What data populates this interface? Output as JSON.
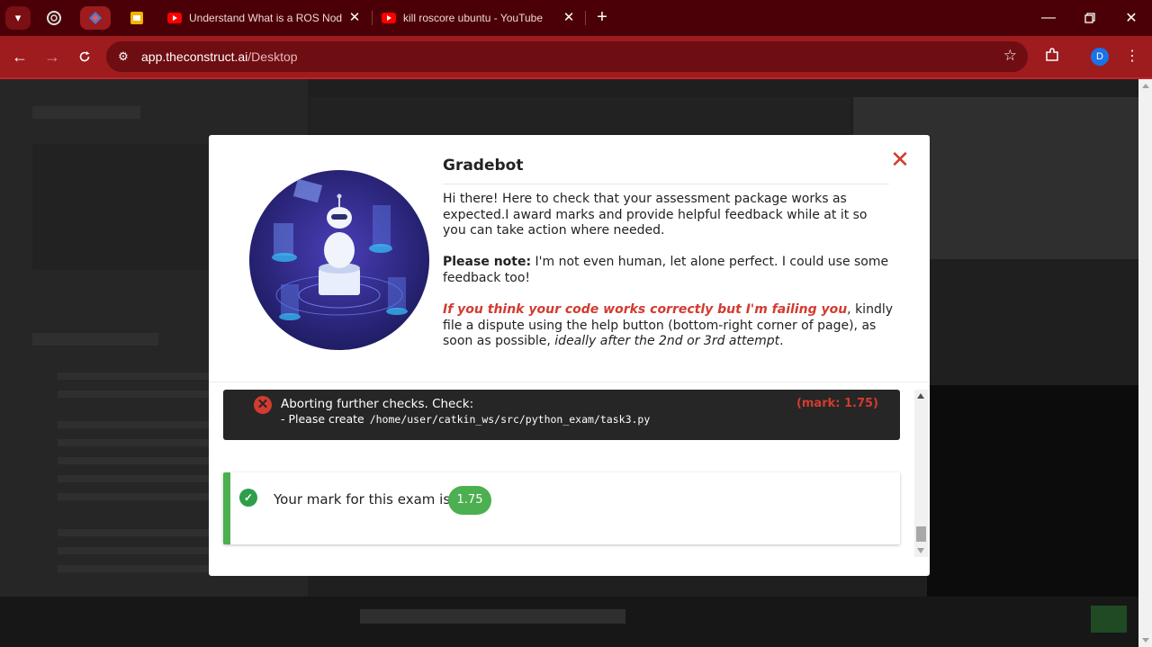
{
  "browser": {
    "tabs": [
      {
        "title": "Understand What is a ROS Node",
        "icon": "youtube-icon"
      },
      {
        "title": "kill roscore ubuntu - YouTube",
        "icon": "youtube-icon"
      }
    ],
    "url_host": "app.theconstruct.ai",
    "url_path": "/Desktop",
    "profile_initial": "D"
  },
  "modal": {
    "title": "Gradebot",
    "intro": "Hi there! Here to check that your assessment package works as expected.I award marks and provide helpful feedback while at it so you can take action where needed.",
    "note_label": "Please note:",
    "note_text": " I'm not even human, let alone perfect. I could use some feedback too!",
    "dispute_warning": "If you think your code works correctly but I'm failing you",
    "dispute_text": ", kindly file a dispute using the help button (bottom-right corner of page), as soon as possible, ",
    "dispute_tail": "ideally after the 2nd or 3rd attempt",
    "dispute_end": ".",
    "error": {
      "heading": "Aborting further checks. Check:",
      "detail_prefix": "- Please create",
      "path": "/home/user/catkin_ws/src/python_exam/task3.py",
      "mark": "(mark: 1.75)"
    },
    "result": {
      "label": "Your mark for this exam is:",
      "score": "1.75"
    }
  },
  "colors": {
    "tabbar": "#4a0006",
    "toolbar": "#9e1b1e",
    "error_red": "#d23b2f",
    "success_green": "#4caf50"
  }
}
